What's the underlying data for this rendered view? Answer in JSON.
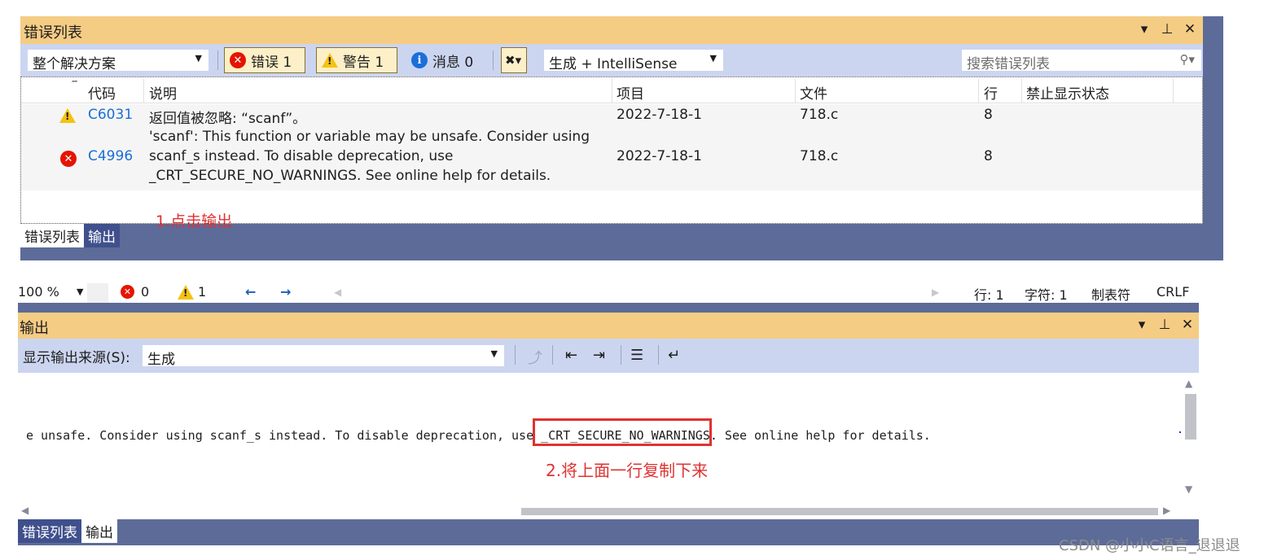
{
  "error_list": {
    "title": "错误列表",
    "controls": {
      "dropdown": "▾",
      "pin": "🖈",
      "close": "✕"
    },
    "scope_combo": "整个解决方案",
    "errors_label": "错误 1",
    "warnings_label": "警告 1",
    "messages_label": "消息 0",
    "build_combo": "生成 + IntelliSense",
    "search_placeholder": "搜索错误列表",
    "columns": {
      "code": "代码",
      "description": "说明",
      "project": "项目",
      "file": "文件",
      "line": "行",
      "suppression": "禁止显示状态"
    },
    "rows": [
      {
        "severity": "warning",
        "code": "C6031",
        "description": [
          "返回值被忽略: “scanf”。"
        ],
        "project": "2022-7-18-1",
        "file": "718.c",
        "line": "8"
      },
      {
        "severity": "error",
        "code": "C4996",
        "description": [
          "'scanf': This function or variable may be unsafe. Consider using",
          "scanf_s instead. To disable deprecation, use",
          "_CRT_SECURE_NO_WARNINGS. See online help for details."
        ],
        "project": "2022-7-18-1",
        "file": "718.c",
        "line": "8"
      }
    ],
    "annotation": "1.点击输出",
    "tabs": [
      "错误列表",
      "输出"
    ]
  },
  "status_strip": {
    "zoom": "100 %",
    "errors": "0",
    "warnings": "1",
    "back": "←",
    "forward": "→",
    "line": "行: 1",
    "char": "字符: 1",
    "tabs": "制表符",
    "eol": "CRLF"
  },
  "output": {
    "title": "输出",
    "source_label": "显示输出来源(S):",
    "source_value": "生成",
    "line_text": "e unsafe. Consider using scanf_s instead. To disable deprecation, use _CRT_SECURE_NO_WARNINGS. See online help for details.",
    "annotation": "2.将上面一行复制下来",
    "tabs": [
      "错误列表",
      "输出"
    ]
  },
  "watermark": "CSDN @小小C语言_退退退"
}
